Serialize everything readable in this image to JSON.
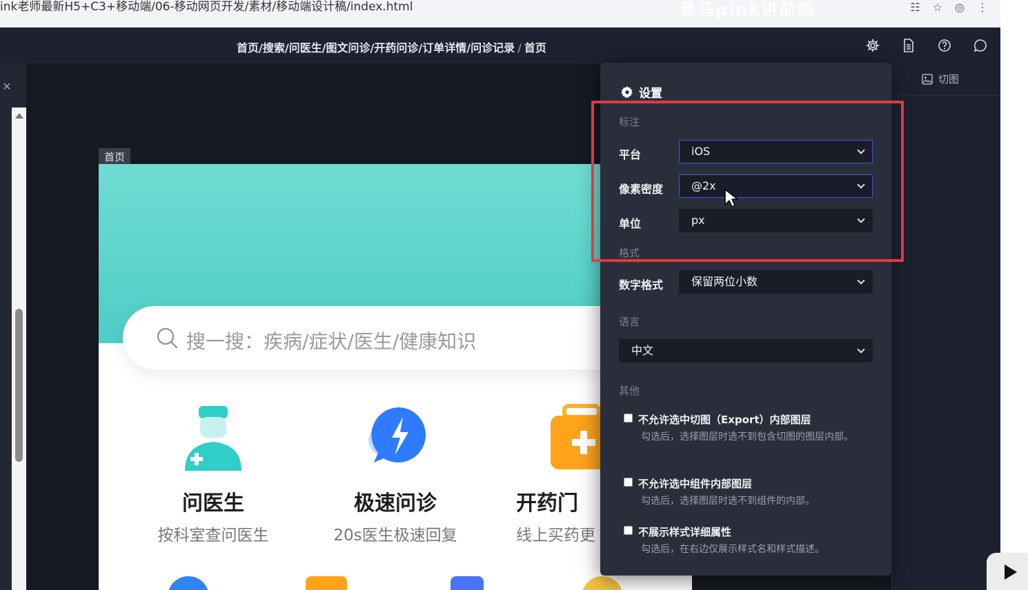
{
  "browser": {
    "url": "ink老师最新H5+C3+移动端/06-移动网页开发/素材/移动端设计稿/index.html",
    "watermark": "黑马pink讲前端"
  },
  "toolbar": {
    "breadcrumb_path": "首页/搜索/问医生/图文问诊/开药问诊/订单详情/问诊记录",
    "breadcrumb_sep": "/",
    "breadcrumb_current": "首页"
  },
  "right_panel": {
    "tab_label": "切图"
  },
  "artboard": {
    "label": "首页",
    "search_placeholder": "搜一搜：疾病/症状/医生/健康知识",
    "features": [
      {
        "title": "问医生",
        "sub": "按科室查问医生"
      },
      {
        "title": "极速问诊",
        "sub": "20s医生极速回复"
      },
      {
        "title": "开药门",
        "sub": "线上买药更"
      }
    ]
  },
  "settings": {
    "title": "设置",
    "section_annotation": "标注",
    "platform_label": "平台",
    "platform_value": "iOS",
    "density_label": "像素密度",
    "density_value": "@2x",
    "unit_label": "单位",
    "unit_value": "px",
    "section_format": "格式",
    "number_format_label": "数字格式",
    "number_format_value": "保留两位小数",
    "section_language": "语言",
    "language_value": "中文",
    "section_other": "其他",
    "options": [
      {
        "label": "不允许选中切图（Export）内部图层",
        "desc": "勾选后，选择图层时选不到包含切图的图层内部。",
        "checked": false
      },
      {
        "label": "不允许选中组件内部图层",
        "desc": "勾选后，选择图层时选不到组件的内部。",
        "checked": false
      },
      {
        "label": "不展示样式详细属性",
        "desc": "勾选后，在右边仅展示样式名和样式描述。",
        "checked": false
      }
    ]
  },
  "colors": {
    "highlight": "#e23a3f",
    "teal": "#4fcdc7",
    "panel": "#2a2e3b",
    "select_focus": "#3b5bdb"
  }
}
